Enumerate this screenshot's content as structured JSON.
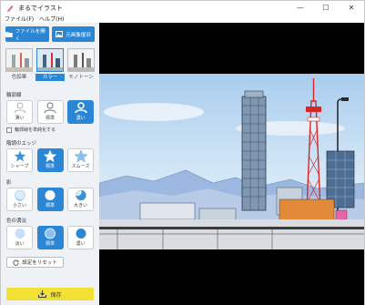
{
  "window": {
    "title": "まるでイラスト",
    "minimize": "—",
    "maximize": "☐",
    "close": "✕"
  },
  "menu": [
    {
      "label": "ファイル(F)"
    },
    {
      "label": "ヘルプ(H)"
    }
  ],
  "toolbar": {
    "open_file": "ファイルを開く",
    "original_image": "元画像復旧"
  },
  "styles": [
    {
      "label": "色鉛筆"
    },
    {
      "label": "カラー"
    },
    {
      "label": "モノトーン"
    }
  ],
  "outline": {
    "title": "輪郭線",
    "options": [
      {
        "label": "薄い"
      },
      {
        "label": "標準"
      },
      {
        "label": "濃い"
      }
    ],
    "simplify": "輪郭線を単純化する"
  },
  "edge": {
    "title": "階調のエッジ",
    "options": [
      {
        "label": "シャープ"
      },
      {
        "label": "標準"
      },
      {
        "label": "スムーズ"
      }
    ]
  },
  "shadow": {
    "title": "影",
    "options": [
      {
        "label": "小さい"
      },
      {
        "label": "標準"
      },
      {
        "label": "大きい"
      }
    ]
  },
  "color_depth": {
    "title": "色の濃淡",
    "options": [
      {
        "label": "淡い"
      },
      {
        "label": "標準"
      },
      {
        "label": "濃い"
      }
    ]
  },
  "reset": "設定をリセット",
  "save": "保存",
  "colors": {
    "accent": "#2c86d6",
    "save": "#f2e132",
    "sidebar": "#eef1f5"
  }
}
